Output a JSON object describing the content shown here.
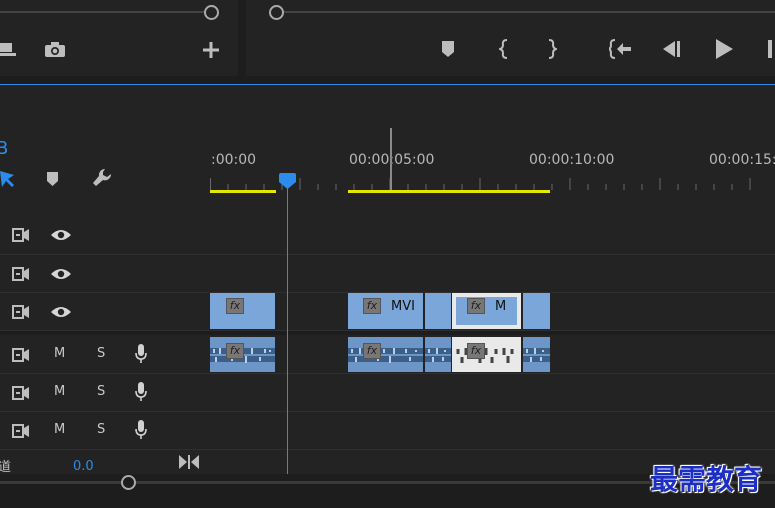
{
  "transport": {
    "play": "play-icon"
  },
  "timeline": {
    "panel_letter": "B",
    "timecodes": [
      ":00:00",
      "00:00:05:00",
      "00:00:10:00",
      "00:00:15:"
    ],
    "clip_label_1": "MVI",
    "clip_label_2": "M",
    "fx_label": "fx"
  },
  "audio": {
    "mute": "M",
    "solo": "S",
    "master_label": "道",
    "master_value": "0.0"
  },
  "watermark": "最需教育",
  "colors": {
    "accent": "#2d8ceb",
    "clip_blue": "#7aa6d9",
    "work_area": "#e6e600",
    "selected_clip": "#e9e9e9"
  }
}
